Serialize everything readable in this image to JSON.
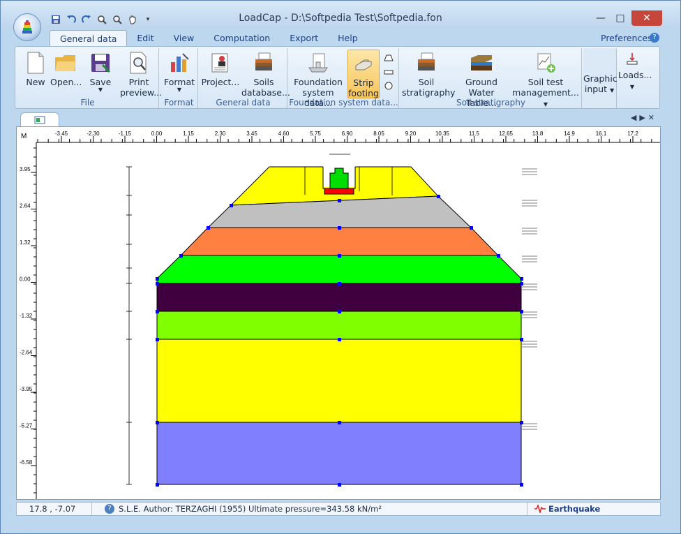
{
  "window": {
    "title": "LoadCap  -  D:\\Softpedia Test\\Softpedia.fon",
    "minimize": "—",
    "maximize": "□",
    "close": "✕"
  },
  "qat": [
    "save-icon",
    "undo-icon",
    "redo-icon",
    "zoom-in-icon",
    "zoom-window-icon",
    "pan-hand-icon",
    "customize-icon"
  ],
  "menu": {
    "tabs": [
      "General data",
      "Edit",
      "View",
      "Computation",
      "Export",
      "Help"
    ],
    "preferences": "Preferences",
    "help_glyph": "?"
  },
  "ribbon": {
    "groups": {
      "file": "File",
      "format": "Format",
      "general": "General data",
      "foundation": "Foundation system data...",
      "soil": "Soil stratigraphy"
    },
    "buttons": {
      "new": "New",
      "open": "Open...",
      "save": "Save",
      "print1": "Print",
      "print2": "preview...",
      "format": "Format",
      "project": "Project...",
      "soils1": "Soils",
      "soils2": "database...",
      "found1": "Foundation",
      "found2": "system data...",
      "strip1": "Strip",
      "strip2": "footing",
      "strat1": "Soil",
      "strat2": "stratigraphy",
      "gw1": "Ground Water",
      "gw2": "Table...",
      "test1": "Soil test",
      "test2": "management...",
      "graphic1": "Graphic",
      "graphic2": "input",
      "loads": "Loads..."
    }
  },
  "ruler": {
    "unit": "M",
    "x_labels": [
      "-3.45",
      "-2.30",
      "-1.15",
      "0.00",
      "1.15",
      "2.30",
      "3.45",
      "4.60",
      "5.75",
      "6.90",
      "8.05",
      "9.20",
      "10.35",
      "11.5",
      "12.65",
      "13.8",
      "14.9",
      "16.1",
      "17.2"
    ],
    "y_labels": [
      "3.95",
      "2.64",
      "1.32",
      "0.00",
      "-1.32",
      "-2.64",
      "-3.95",
      "-5.27",
      "-6.58"
    ]
  },
  "section": {
    "layer_colors": [
      "#ffff00",
      "#c0c0c0",
      "#ff8040",
      "#00ff00",
      "#400040",
      "#80ff00",
      "#ffff00",
      "#8080ff"
    ],
    "footing_colors": {
      "stem": "#00dd00",
      "base": "#ff0000"
    },
    "node_color": "#0000ff"
  },
  "status": {
    "coords": "17.8 , -7.07",
    "help_glyph": "?",
    "message": "S.L.E. Author: TERZAGHI (1955) Ultimate pressure=343.58 kN/m²",
    "earthquake": "Earthquake"
  }
}
